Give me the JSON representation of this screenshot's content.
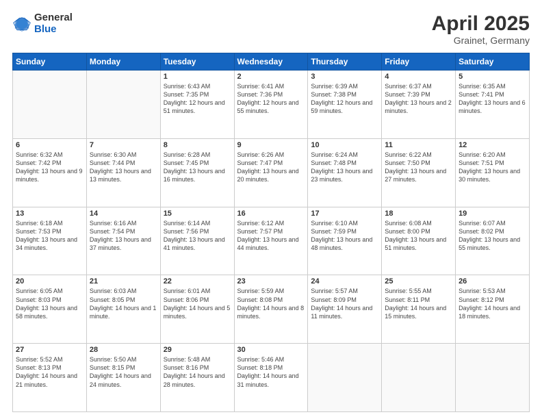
{
  "header": {
    "logo_general": "General",
    "logo_blue": "Blue",
    "title": "April 2025",
    "subtitle": "Grainet, Germany"
  },
  "days_of_week": [
    "Sunday",
    "Monday",
    "Tuesday",
    "Wednesday",
    "Thursday",
    "Friday",
    "Saturday"
  ],
  "weeks": [
    [
      {
        "day": "",
        "info": ""
      },
      {
        "day": "",
        "info": ""
      },
      {
        "day": "1",
        "info": "Sunrise: 6:43 AM\nSunset: 7:35 PM\nDaylight: 12 hours and 51 minutes."
      },
      {
        "day": "2",
        "info": "Sunrise: 6:41 AM\nSunset: 7:36 PM\nDaylight: 12 hours and 55 minutes."
      },
      {
        "day": "3",
        "info": "Sunrise: 6:39 AM\nSunset: 7:38 PM\nDaylight: 12 hours and 59 minutes."
      },
      {
        "day": "4",
        "info": "Sunrise: 6:37 AM\nSunset: 7:39 PM\nDaylight: 13 hours and 2 minutes."
      },
      {
        "day": "5",
        "info": "Sunrise: 6:35 AM\nSunset: 7:41 PM\nDaylight: 13 hours and 6 minutes."
      }
    ],
    [
      {
        "day": "6",
        "info": "Sunrise: 6:32 AM\nSunset: 7:42 PM\nDaylight: 13 hours and 9 minutes."
      },
      {
        "day": "7",
        "info": "Sunrise: 6:30 AM\nSunset: 7:44 PM\nDaylight: 13 hours and 13 minutes."
      },
      {
        "day": "8",
        "info": "Sunrise: 6:28 AM\nSunset: 7:45 PM\nDaylight: 13 hours and 16 minutes."
      },
      {
        "day": "9",
        "info": "Sunrise: 6:26 AM\nSunset: 7:47 PM\nDaylight: 13 hours and 20 minutes."
      },
      {
        "day": "10",
        "info": "Sunrise: 6:24 AM\nSunset: 7:48 PM\nDaylight: 13 hours and 23 minutes."
      },
      {
        "day": "11",
        "info": "Sunrise: 6:22 AM\nSunset: 7:50 PM\nDaylight: 13 hours and 27 minutes."
      },
      {
        "day": "12",
        "info": "Sunrise: 6:20 AM\nSunset: 7:51 PM\nDaylight: 13 hours and 30 minutes."
      }
    ],
    [
      {
        "day": "13",
        "info": "Sunrise: 6:18 AM\nSunset: 7:53 PM\nDaylight: 13 hours and 34 minutes."
      },
      {
        "day": "14",
        "info": "Sunrise: 6:16 AM\nSunset: 7:54 PM\nDaylight: 13 hours and 37 minutes."
      },
      {
        "day": "15",
        "info": "Sunrise: 6:14 AM\nSunset: 7:56 PM\nDaylight: 13 hours and 41 minutes."
      },
      {
        "day": "16",
        "info": "Sunrise: 6:12 AM\nSunset: 7:57 PM\nDaylight: 13 hours and 44 minutes."
      },
      {
        "day": "17",
        "info": "Sunrise: 6:10 AM\nSunset: 7:59 PM\nDaylight: 13 hours and 48 minutes."
      },
      {
        "day": "18",
        "info": "Sunrise: 6:08 AM\nSunset: 8:00 PM\nDaylight: 13 hours and 51 minutes."
      },
      {
        "day": "19",
        "info": "Sunrise: 6:07 AM\nSunset: 8:02 PM\nDaylight: 13 hours and 55 minutes."
      }
    ],
    [
      {
        "day": "20",
        "info": "Sunrise: 6:05 AM\nSunset: 8:03 PM\nDaylight: 13 hours and 58 minutes."
      },
      {
        "day": "21",
        "info": "Sunrise: 6:03 AM\nSunset: 8:05 PM\nDaylight: 14 hours and 1 minute."
      },
      {
        "day": "22",
        "info": "Sunrise: 6:01 AM\nSunset: 8:06 PM\nDaylight: 14 hours and 5 minutes."
      },
      {
        "day": "23",
        "info": "Sunrise: 5:59 AM\nSunset: 8:08 PM\nDaylight: 14 hours and 8 minutes."
      },
      {
        "day": "24",
        "info": "Sunrise: 5:57 AM\nSunset: 8:09 PM\nDaylight: 14 hours and 11 minutes."
      },
      {
        "day": "25",
        "info": "Sunrise: 5:55 AM\nSunset: 8:11 PM\nDaylight: 14 hours and 15 minutes."
      },
      {
        "day": "26",
        "info": "Sunrise: 5:53 AM\nSunset: 8:12 PM\nDaylight: 14 hours and 18 minutes."
      }
    ],
    [
      {
        "day": "27",
        "info": "Sunrise: 5:52 AM\nSunset: 8:13 PM\nDaylight: 14 hours and 21 minutes."
      },
      {
        "day": "28",
        "info": "Sunrise: 5:50 AM\nSunset: 8:15 PM\nDaylight: 14 hours and 24 minutes."
      },
      {
        "day": "29",
        "info": "Sunrise: 5:48 AM\nSunset: 8:16 PM\nDaylight: 14 hours and 28 minutes."
      },
      {
        "day": "30",
        "info": "Sunrise: 5:46 AM\nSunset: 8:18 PM\nDaylight: 14 hours and 31 minutes."
      },
      {
        "day": "",
        "info": ""
      },
      {
        "day": "",
        "info": ""
      },
      {
        "day": "",
        "info": ""
      }
    ]
  ]
}
